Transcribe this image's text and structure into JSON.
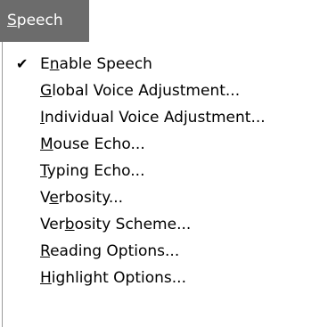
{
  "menubar": {
    "title": {
      "pre": "",
      "mn": "S",
      "post": "peech"
    }
  },
  "menu": {
    "items": [
      {
        "checked": true,
        "pre": "E",
        "mn": "n",
        "post": "able Speech"
      },
      {
        "checked": false,
        "pre": "",
        "mn": "G",
        "post": "lobal Voice Adjustment..."
      },
      {
        "checked": false,
        "pre": "",
        "mn": "I",
        "post": "ndividual Voice Adjustment..."
      },
      {
        "checked": false,
        "pre": "",
        "mn": "M",
        "post": "ouse Echo..."
      },
      {
        "checked": false,
        "pre": "",
        "mn": "T",
        "post": "yping Echo..."
      },
      {
        "checked": false,
        "pre": "V",
        "mn": "e",
        "post": "rbosity..."
      },
      {
        "checked": false,
        "pre": "Ver",
        "mn": "b",
        "post": "osity Scheme..."
      },
      {
        "checked": false,
        "pre": "",
        "mn": "R",
        "post": "eading Options..."
      },
      {
        "checked": false,
        "pre": "",
        "mn": "H",
        "post": "ighlight Options..."
      }
    ],
    "check_glyph": "✔"
  }
}
